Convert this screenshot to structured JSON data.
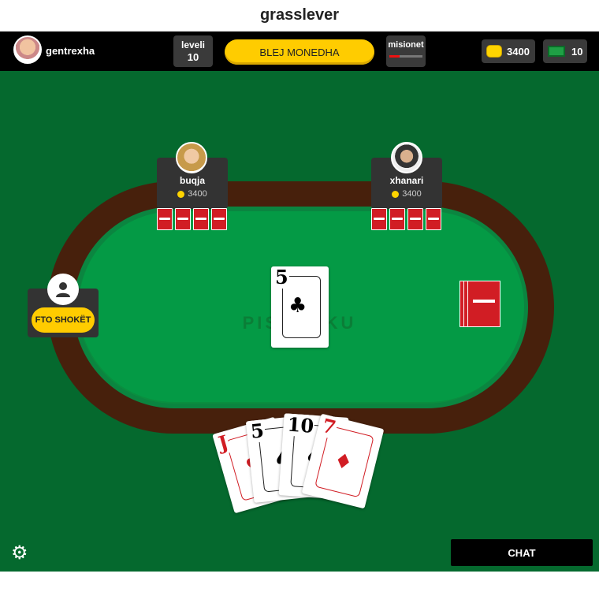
{
  "window": {
    "title": "grasslever"
  },
  "topbar": {
    "username": "gentrexha",
    "level_label": "leveli",
    "level_value": "10",
    "buy_label": "BLEJ MONEDHA",
    "missions_label": "misionet",
    "missions_progress": 0.3,
    "coins": "3400",
    "cash": "10"
  },
  "table": {
    "logo_text": "PISHTI KU",
    "players": [
      {
        "name": "buqja",
        "chips": "3400",
        "card_count": 4
      },
      {
        "name": "xhanari",
        "chips": "3400",
        "card_count": 4
      }
    ],
    "empty_seat": {
      "invite_label": "FTO SHOKËT"
    },
    "pile_card": {
      "rank": "5",
      "suit": "♣"
    },
    "deck_cards": 3
  },
  "hand": [
    {
      "rank": "J",
      "suit": "♥",
      "color": "red"
    },
    {
      "rank": "5",
      "suit": "♠",
      "color": "black"
    },
    {
      "rank": "10",
      "suit": "♠",
      "color": "black"
    },
    {
      "rank": "7",
      "suit": "♦",
      "color": "red"
    }
  ],
  "footer": {
    "chat_label": "CHAT"
  },
  "colors": {
    "felt": "#05692e",
    "table": "#049a45",
    "rail": "#47200c",
    "accent": "#ffcc00",
    "card_back": "#d11d24"
  }
}
